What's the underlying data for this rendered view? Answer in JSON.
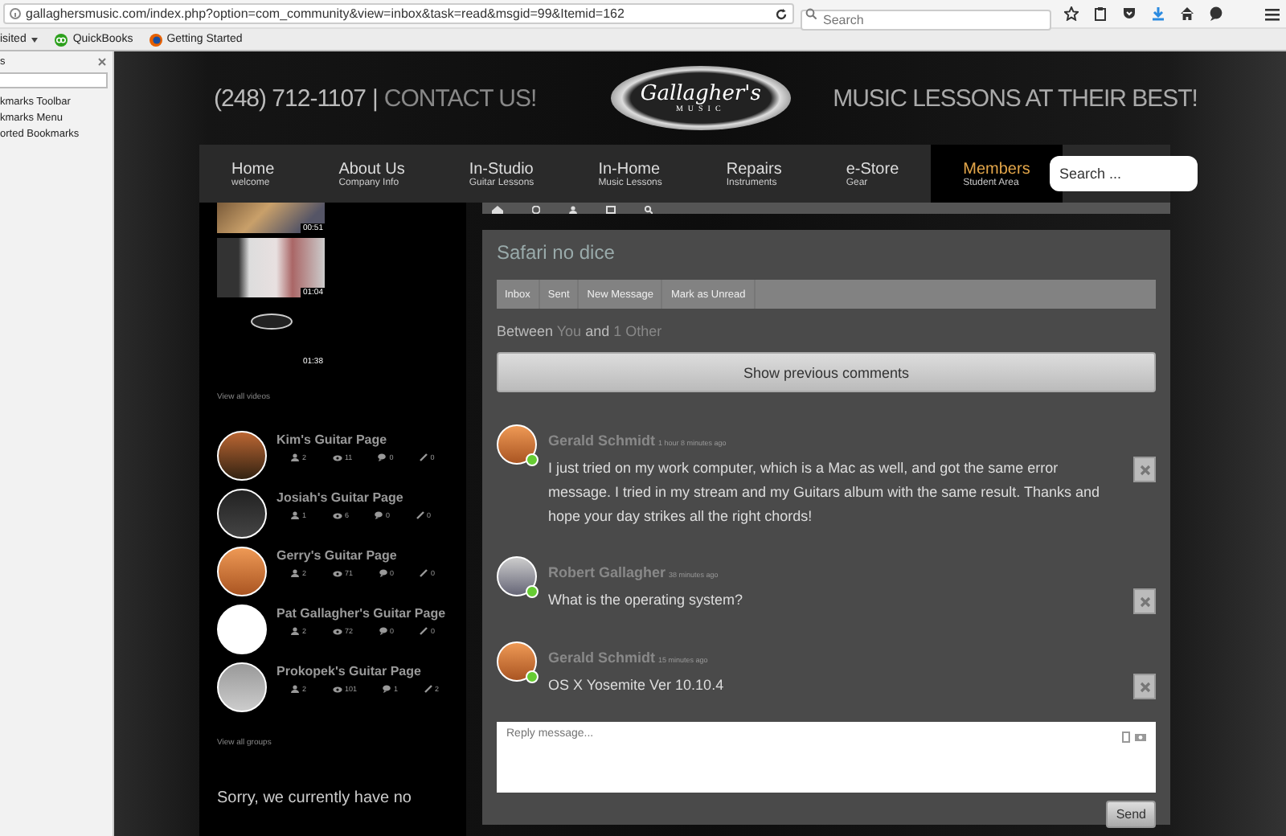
{
  "browser": {
    "url": "gallaghersmusic.com/index.php?option=com_community&view=inbox&task=read&msgid=99&Itemid=162",
    "search_placeholder": "Search"
  },
  "bookmarks": [
    {
      "label": "isited",
      "kind": "menu"
    },
    {
      "label": "QuickBooks",
      "kind": "quickbooks"
    },
    {
      "label": "Getting Started",
      "kind": "browser"
    }
  ],
  "sidebar": {
    "title": "s",
    "items": [
      "kmarks Toolbar",
      "kmarks Menu",
      "orted Bookmarks"
    ]
  },
  "header": {
    "phone": "(248) 712-1107",
    "divider": "|",
    "contact": "CONTACT US!",
    "logo_script": "Gallagher's",
    "logo_sub": "MUSIC",
    "tagline": "MUSIC LESSONS AT THEIR BEST!"
  },
  "nav": {
    "items": [
      {
        "label": "Home",
        "sub": "welcome",
        "selected": false
      },
      {
        "label": "About Us",
        "sub": "Company Info",
        "selected": false
      },
      {
        "label": "In-Studio",
        "sub": "Guitar Lessons",
        "selected": false
      },
      {
        "label": "In-Home",
        "sub": "Music Lessons",
        "selected": false
      },
      {
        "label": "Repairs",
        "sub": "Instruments",
        "selected": false
      },
      {
        "label": "e-Store",
        "sub": "Gear",
        "selected": false
      },
      {
        "label": "Members",
        "sub": "Student Area",
        "selected": true
      }
    ],
    "search_placeholder": "Search ..."
  },
  "videos": {
    "items": [
      {
        "kind": "photo",
        "duration": "00:51"
      },
      {
        "kind": "photo",
        "duration": "01:04"
      },
      {
        "kind": "logo",
        "duration": "01:38"
      }
    ],
    "view_all": "View all videos"
  },
  "groups": {
    "items": [
      {
        "name": "Kim's Guitar Page",
        "members": "2",
        "views": "11",
        "comments": "0",
        "edits": "0"
      },
      {
        "name": "Josiah's Guitar Page",
        "members": "1",
        "views": "6",
        "comments": "0",
        "edits": "0"
      },
      {
        "name": "Gerry's Guitar Page",
        "members": "2",
        "views": "71",
        "comments": "0",
        "edits": "0"
      },
      {
        "name": "Pat Gallagher's Guitar Page",
        "members": "2",
        "views": "72",
        "comments": "0",
        "edits": "0"
      },
      {
        "name": "Prokopek's Guitar Page",
        "members": "2",
        "views": "101",
        "comments": "1",
        "edits": "2"
      }
    ],
    "view_all": "View all groups"
  },
  "events_text": "Sorry, we currently have no",
  "conversation": {
    "title": "Safari no dice",
    "tabs": [
      "Inbox",
      "Sent",
      "New Message",
      "Mark as Unread"
    ],
    "between": {
      "prefix": "Between",
      "you": "You",
      "and": "and",
      "other": "1 Other"
    },
    "show_previous": "Show previous comments",
    "messages": [
      {
        "author": "Gerald Schmidt",
        "time": "1 hour 8 minutes ago",
        "text": "I just tried on my work computer, which is a Mac as well, and got the same error message. I tried in my stream and my Guitars album with the same result. Thanks and hope your day strikes all the right chords!",
        "online": true
      },
      {
        "author": "Robert Gallagher",
        "time": "38 minutes ago",
        "text": "What is the operating system?",
        "online": true
      },
      {
        "author": "Gerald Schmidt",
        "time": "15 minutes ago",
        "text": "OS X Yosemite Ver 10.10.4",
        "online": true
      }
    ],
    "reply_placeholder": "Reply message...",
    "send": "Send"
  }
}
